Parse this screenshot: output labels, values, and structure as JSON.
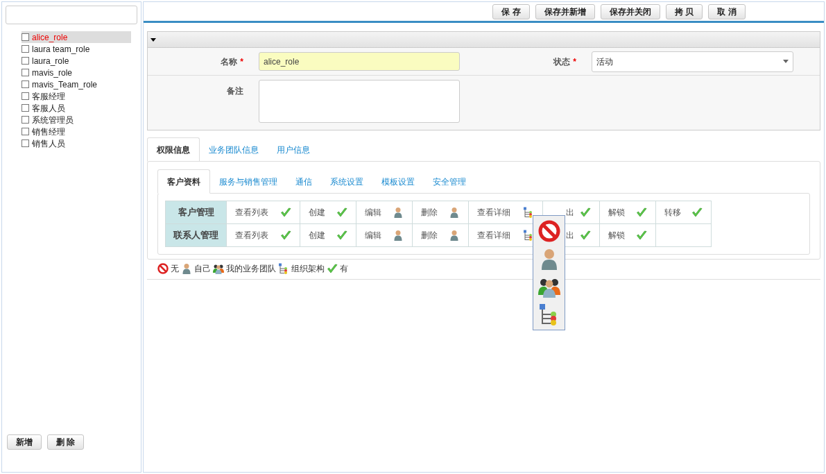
{
  "sidebar": {
    "items": [
      {
        "label": "alice_role",
        "selected": true,
        "checked": false
      },
      {
        "label": "laura team_role",
        "selected": false,
        "checked": false
      },
      {
        "label": "laura_role",
        "selected": false,
        "checked": false
      },
      {
        "label": "mavis_role",
        "selected": false,
        "checked": false
      },
      {
        "label": "mavis_Team_role",
        "selected": false,
        "checked": false
      },
      {
        "label": "客服经理",
        "selected": false,
        "checked": false
      },
      {
        "label": "客服人员",
        "selected": false,
        "checked": false
      },
      {
        "label": "系统管理员",
        "selected": false,
        "checked": false
      },
      {
        "label": "销售经理",
        "selected": false,
        "checked": false
      },
      {
        "label": "销售人员",
        "selected": false,
        "checked": false
      }
    ],
    "buttons": [
      "新增",
      "删 除"
    ]
  },
  "toolbar": [
    "保 存",
    "保存并新增",
    "保存并关闭",
    "拷 贝",
    "取 消"
  ],
  "section": {
    "expanded": true,
    "fields": [
      {
        "kind": "text",
        "label": "名称",
        "required_mark": "*",
        "value": "alice_role"
      },
      {
        "kind": "select",
        "label": "状态",
        "required_mark": "*",
        "value": "活动"
      },
      {
        "kind": "textarea",
        "label": "备注"
      }
    ]
  },
  "tabs": [
    {
      "label": "权限信息",
      "selected": true
    },
    {
      "label": "业务团队信息",
      "selected": false
    },
    {
      "label": "用户信息",
      "selected": false
    }
  ],
  "subtabs": [
    {
      "label": "客户资料",
      "selected": true
    },
    {
      "label": "服务与销售管理",
      "selected": false
    },
    {
      "label": "通信",
      "selected": false
    },
    {
      "label": "系统设置",
      "selected": false
    },
    {
      "label": "模板设置",
      "selected": false
    },
    {
      "label": "安全管理",
      "selected": false
    }
  ],
  "permissions": [
    {
      "module": "客户管理",
      "cells": [
        {
          "label": "查看列表",
          "kind": "all"
        },
        {
          "label": "创建",
          "kind": "all"
        },
        {
          "label": "编辑",
          "kind": "self"
        },
        {
          "label": "删除",
          "kind": "self"
        },
        {
          "label": "查看详细",
          "kind": "org"
        },
        {
          "label": "出",
          "kind": "all",
          "covered": true
        },
        {
          "label": "解锁",
          "kind": "all"
        },
        {
          "label": "转移",
          "kind": "all"
        }
      ]
    },
    {
      "module": "联系人管理",
      "cells": [
        {
          "label": "查看列表",
          "kind": "all"
        },
        {
          "label": "创建",
          "kind": "all"
        },
        {
          "label": "编辑",
          "kind": "self"
        },
        {
          "label": "删除",
          "kind": "self"
        },
        {
          "label": "查看详细",
          "kind": "org"
        },
        {
          "label": "出",
          "kind": "all",
          "covered": true
        },
        {
          "label": "解锁",
          "kind": "all"
        }
      ]
    }
  ],
  "legend": [
    {
      "kind": "none",
      "label": "无"
    },
    {
      "kind": "self",
      "label": "自己"
    },
    {
      "kind": "team",
      "label": "我的业务团队"
    },
    {
      "kind": "org",
      "label": "组织架构"
    },
    {
      "kind": "all",
      "label": "有"
    }
  ],
  "popup": {
    "options": [
      {
        "kind": "none"
      },
      {
        "kind": "self"
      },
      {
        "kind": "team"
      },
      {
        "kind": "org"
      }
    ]
  }
}
